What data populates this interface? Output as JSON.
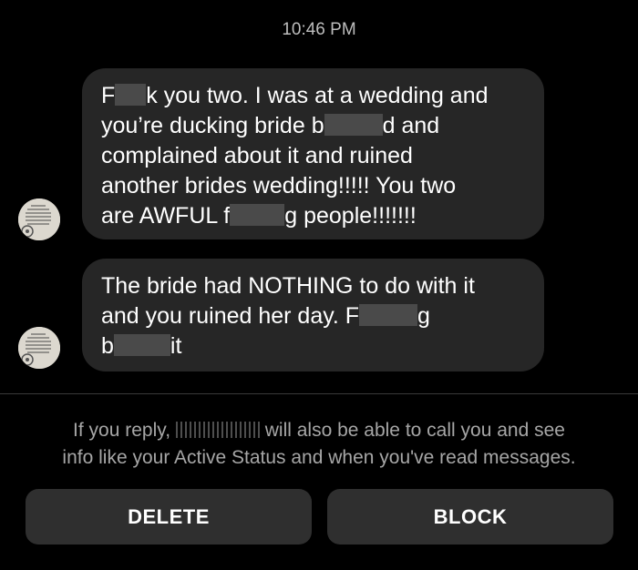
{
  "status": {
    "time": "10:46 PM"
  },
  "messages": [
    {
      "lines": [
        [
          "F",
          "",
          "k you two. I was at a wedding and"
        ],
        [
          "you’re ducking bride b",
          "",
          "d and"
        ],
        [
          "complained about it and ruined"
        ],
        [
          "another brides wedding!!!!! You two"
        ],
        [
          "are AWFUL f",
          "",
          "g people!!!!!!!"
        ]
      ]
    },
    {
      "lines": [
        [
          "The bride had NOTHING to do with it"
        ],
        [
          "and you ruined her day. F",
          "",
          "g"
        ],
        [
          "b",
          "",
          "it"
        ]
      ]
    }
  ],
  "notice": {
    "line1_before": "If you reply,",
    "line1_after": "will also be able to call you and see",
    "line2": "info like your Active Status and when you've read messages."
  },
  "actions": {
    "delete_label": "DELETE",
    "block_label": "BLOCK"
  },
  "colors": {
    "background": "#000000",
    "bubble": "#262626",
    "button": "#2f2f2f",
    "muted_text": "#a6a6a6"
  }
}
